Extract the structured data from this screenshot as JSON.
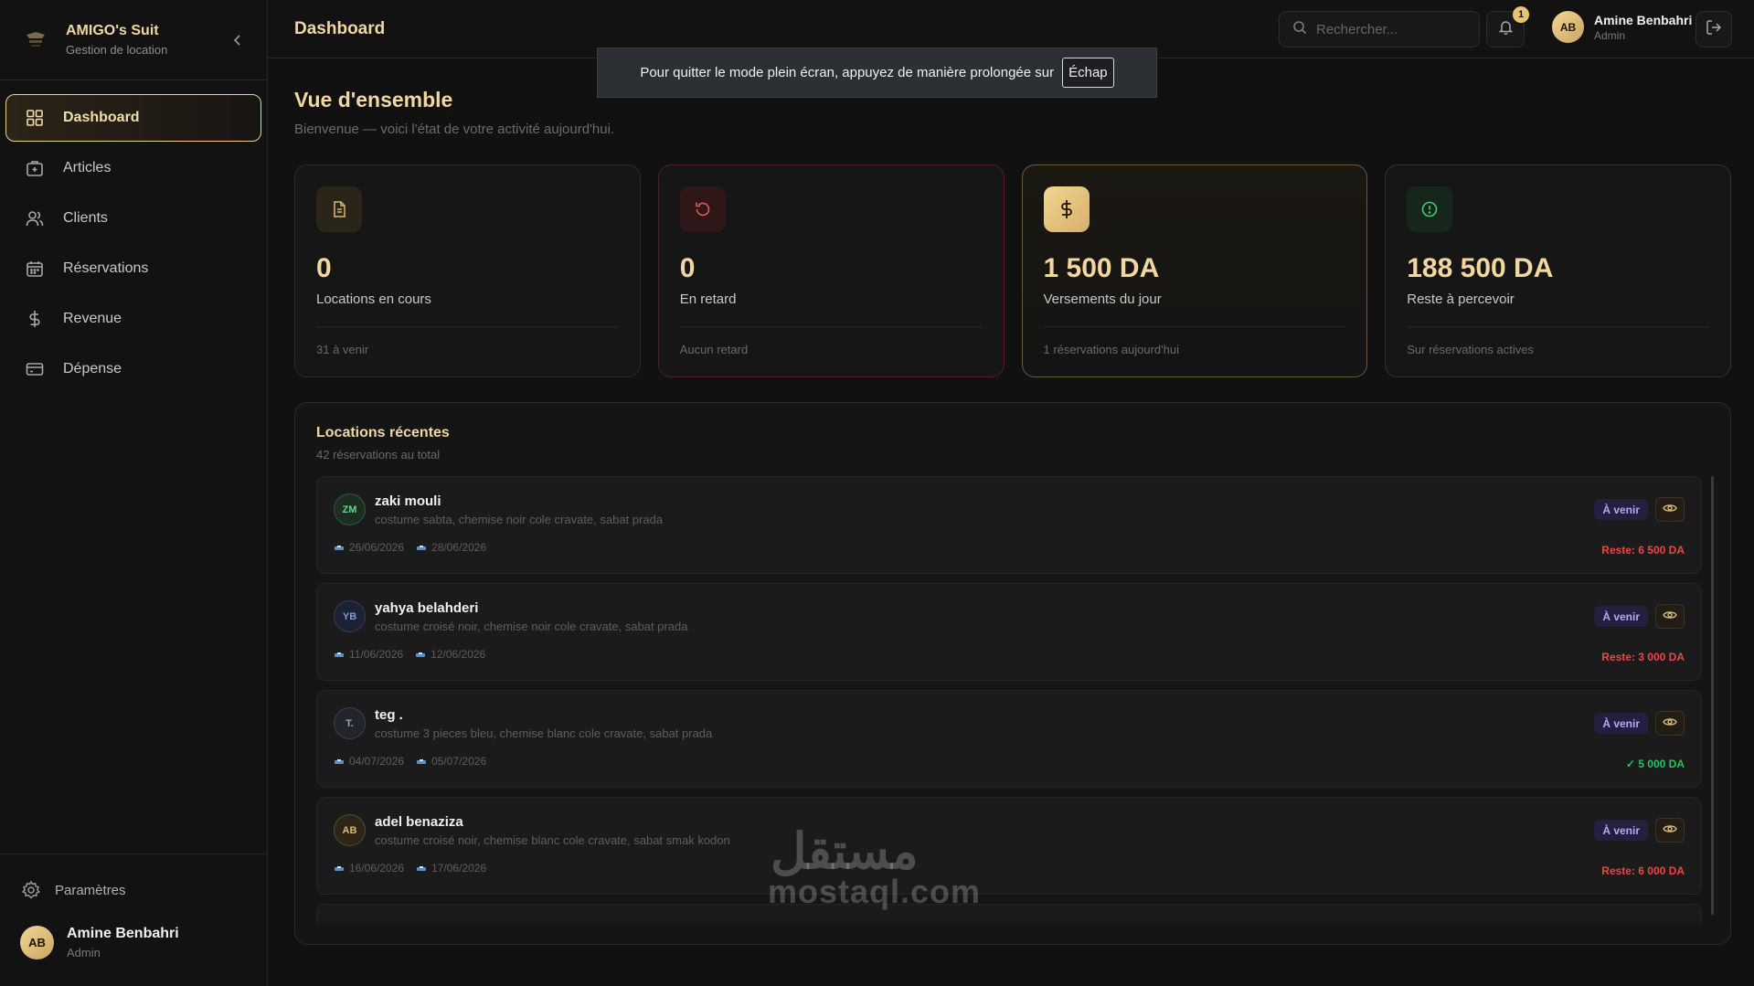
{
  "brand": {
    "title": "AMIGO's Suit",
    "subtitle": "Gestion de location"
  },
  "nav": [
    {
      "label": "Dashboard",
      "icon": "grid-icon",
      "active": true
    },
    {
      "label": "Articles",
      "icon": "package-icon"
    },
    {
      "label": "Clients",
      "icon": "users-icon"
    },
    {
      "label": "Réservations",
      "icon": "calendar-icon"
    },
    {
      "label": "Revenue",
      "icon": "dollar-icon"
    },
    {
      "label": "Dépense",
      "icon": "credit-card-icon"
    }
  ],
  "settings_label": "Paramètres",
  "user": {
    "initials": "AB",
    "name": "Amine Benbahri",
    "role": "Admin"
  },
  "topbar": {
    "title": "Dashboard",
    "search_placeholder": "Rechercher...",
    "notification_count": "1"
  },
  "toast": {
    "text": "Pour quitter le mode plein écran, appuyez de manière prolongée sur",
    "key": "Échap"
  },
  "page": {
    "title": "Vue d'ensemble",
    "subtitle": "Bienvenue — voici l'état de votre activité aujourd'hui."
  },
  "stats": [
    {
      "value": "0",
      "label": "Locations en cours",
      "foot": "31 à venir",
      "icon": "document-icon"
    },
    {
      "value": "0",
      "label": "En retard",
      "foot": "Aucun retard",
      "icon": "rotate-icon"
    },
    {
      "value": "1 500 DA",
      "label": "Versements du jour",
      "foot": "1 réservations aujourd'hui",
      "icon": "dollar-icon"
    },
    {
      "value": "188 500 DA",
      "label": "Reste à percevoir",
      "foot": "Sur réservations actives",
      "icon": "alert-circle-icon"
    }
  ],
  "recent": {
    "title": "Locations récentes",
    "subtitle": "42 réservations au total",
    "rows": [
      {
        "initials": "ZM",
        "name": "zaki mouli",
        "items": "costume sabta, chemise noir cole cravate, sabat prada",
        "start": "26/06/2026",
        "end": "28/06/2026",
        "status": "À venir",
        "amount": "Reste: 6 500 DA",
        "amount_color": "#ef4444"
      },
      {
        "initials": "YB",
        "name": "yahya belahderi",
        "items": "costume croisé noir, chemise noir cole cravate, sabat prada",
        "start": "11/06/2026",
        "end": "12/06/2026",
        "status": "À venir",
        "amount": "Reste: 3 000 DA",
        "amount_color": "#ef4444"
      },
      {
        "initials": "T.",
        "name": "teg .",
        "items": "costume 3 pieces bleu, chemise blanc cole cravate, sabat prada",
        "start": "04/07/2026",
        "end": "05/07/2026",
        "status": "À venir",
        "amount": "✓ 5 000 DA",
        "amount_color": "#22c55e"
      },
      {
        "initials": "AB",
        "name": "adel benaziza",
        "items": "costume croisé noir, chemise blanc cole cravate, sabat smak kodon",
        "start": "16/06/2026",
        "end": "17/06/2026",
        "status": "À venir",
        "amount": "Reste: 6 000 DA",
        "amount_color": "#ef4444"
      }
    ]
  },
  "watermark": {
    "arabic": "مستقل",
    "latin": "mostaql.com"
  },
  "colors": {
    "accent": "#f1d7a0",
    "gold": "#e8c46c",
    "danger": "#ef4444",
    "success": "#22c55e",
    "status_bg": "#241f3f",
    "status_fg": "#b5a8f5"
  }
}
